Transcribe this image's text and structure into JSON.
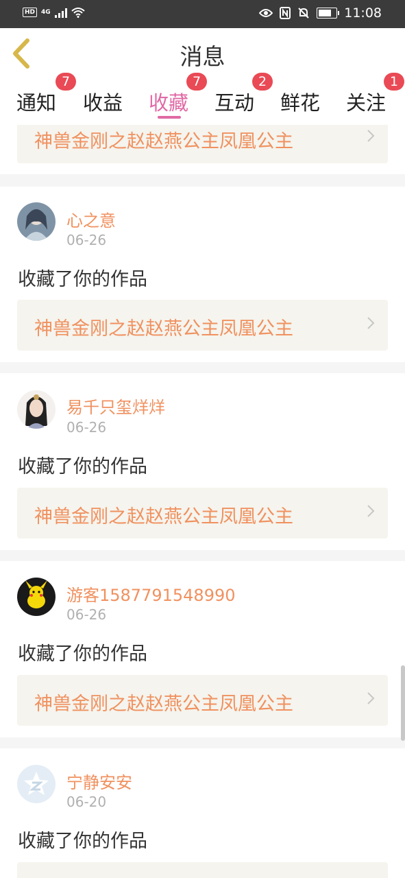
{
  "status_bar": {
    "network_hd": "HD",
    "network_4g": "4G",
    "time": "11:08"
  },
  "header": {
    "title": "消息"
  },
  "tabs": [
    {
      "label": "通知",
      "badge": "7"
    },
    {
      "label": "收益",
      "badge": ""
    },
    {
      "label": "收藏",
      "badge": "7",
      "active": true
    },
    {
      "label": "互动",
      "badge": "2"
    },
    {
      "label": "鲜花",
      "badge": ""
    },
    {
      "label": "关注",
      "badge": "1"
    }
  ],
  "top_card": {
    "work_title": "神兽金刚之赵赵燕公主凤凰公主"
  },
  "items": [
    {
      "user": "心之意",
      "date": "06-26",
      "action": "收藏了你的作品",
      "work_title": "神兽金刚之赵赵燕公主凤凰公主"
    },
    {
      "user": "易千只玺烊烊",
      "date": "06-26",
      "action": "收藏了你的作品",
      "work_title": "神兽金刚之赵赵燕公主凤凰公主"
    },
    {
      "user": "游客1587791548990",
      "date": "06-26",
      "action": "收藏了你的作品",
      "work_title": "神兽金刚之赵赵燕公主凤凰公主"
    },
    {
      "user": "宁静安安",
      "date": "06-20",
      "action": "收藏了你的作品",
      "work_title": ""
    }
  ],
  "colors": {
    "accent_pink": "#e06aa5",
    "orange_text": "#f0915f",
    "badge_red": "#e94a55",
    "card_bg": "#f5f4ee"
  },
  "icons": [
    "back-chevron-icon",
    "eye-icon",
    "nfc-icon",
    "mute-bell-icon",
    "battery-icon",
    "wifi-icon",
    "chevron-right-icon"
  ]
}
